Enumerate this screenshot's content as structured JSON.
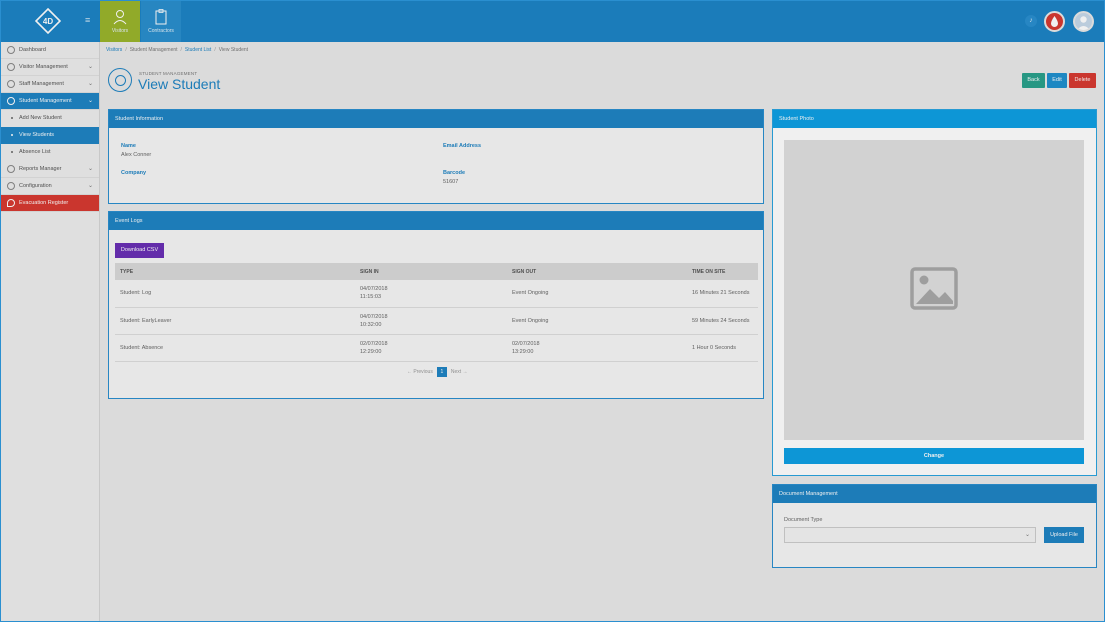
{
  "topbar": {
    "logo_text": "4D",
    "nav": [
      {
        "label": "Visitors",
        "icon": "user-icon"
      },
      {
        "label": "Contractors",
        "icon": "clipboard-icon"
      }
    ],
    "bell_icon": "bell-icon",
    "alert_icon": "blood-drop-icon",
    "avatar_icon": "user-avatar-icon"
  },
  "sidebar": {
    "items": [
      {
        "label": "Dashboard"
      },
      {
        "label": "Visitor Management"
      },
      {
        "label": "Staff Management"
      },
      {
        "label": "Student Management"
      },
      {
        "label": "Add New Student"
      },
      {
        "label": "View Students"
      },
      {
        "label": "Absence List"
      },
      {
        "label": "Reports Manager"
      },
      {
        "label": "Configuration"
      },
      {
        "label": "Evacuation Register"
      }
    ]
  },
  "breadcrumb": [
    "Visitors",
    "Student Management",
    "Student List",
    "View Student"
  ],
  "header": {
    "kicker": "STUDENT MANAGEMENT",
    "title": "View Student",
    "buttons": {
      "back": "Back",
      "edit": "Edit",
      "delete": "Delete"
    }
  },
  "student_info": {
    "title": "Student Information",
    "name_label": "Name",
    "name_value": "Alex Conner",
    "email_label": "Email Address",
    "email_value": "",
    "company_label": "Company",
    "company_value": "",
    "barcode_label": "Barcode",
    "barcode_value": "51607"
  },
  "event_logs": {
    "title": "Event Logs",
    "download_label": "Download CSV",
    "columns": [
      "TYPE",
      "SIGN IN",
      "SIGN OUT",
      "TIME ON SITE"
    ],
    "rows": [
      {
        "type": "Student: Log",
        "sign_in_date": "04/07/2018",
        "sign_in_time": "11:15:03",
        "sign_out_date": "Event Ongoing",
        "sign_out_time": "",
        "time_on_site": "16 Minutes 21 Seconds"
      },
      {
        "type": "Student: EarlyLeaver",
        "sign_in_date": "04/07/2018",
        "sign_in_time": "10:32:00",
        "sign_out_date": "Event Ongoing",
        "sign_out_time": "",
        "time_on_site": "59 Minutes 24 Seconds"
      },
      {
        "type": "Student: Absence",
        "sign_in_date": "02/07/2018",
        "sign_in_time": "12:29:00",
        "sign_out_date": "02/07/2018",
        "sign_out_time": "13:29:00",
        "time_on_site": "1 Hour 0 Seconds"
      }
    ],
    "pager": {
      "previous": "← Previous",
      "current": "1",
      "next": "Next →"
    }
  },
  "photo": {
    "title": "Student Photo",
    "placeholder_icon": "image-placeholder-icon",
    "change_label": "Change"
  },
  "documents": {
    "title": "Document Management",
    "type_label": "Document Type",
    "selected": "",
    "upload_label": "Upload File"
  }
}
